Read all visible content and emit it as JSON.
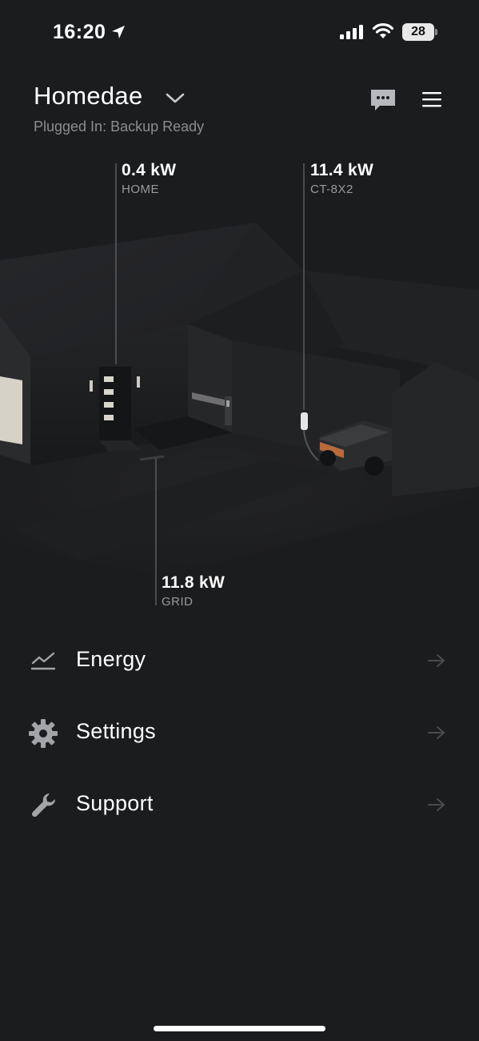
{
  "status_bar": {
    "time": "16:20",
    "battery": "28",
    "icons": [
      "location-arrow-icon",
      "cellular-signal-icon",
      "wifi-icon",
      "battery-icon"
    ]
  },
  "header": {
    "site_name": "Homedae",
    "site_status": "Plugged In: Backup Ready",
    "icons": [
      "chevron-down-icon",
      "chat-icon",
      "hamburger-menu-icon"
    ]
  },
  "energy_flow": {
    "home": {
      "value": "0.4 kW",
      "label": "HOME"
    },
    "vehicle": {
      "value": "11.4 kW",
      "label": "CT-8X2"
    },
    "grid": {
      "value": "11.8 kW",
      "label": "GRID"
    }
  },
  "menu": {
    "items": [
      {
        "label": "Energy",
        "icon": "line-chart-icon"
      },
      {
        "label": "Settings",
        "icon": "gear-icon"
      },
      {
        "label": "Support",
        "icon": "wrench-icon"
      }
    ]
  },
  "colors": {
    "background": "#1b1c1e",
    "text_primary": "#ffffff",
    "text_secondary": "#8c8d90",
    "icon_grey": "#9a9b9e",
    "arrow_grey": "#4a4b4e",
    "vehicle_accent": "#b86a3c"
  }
}
